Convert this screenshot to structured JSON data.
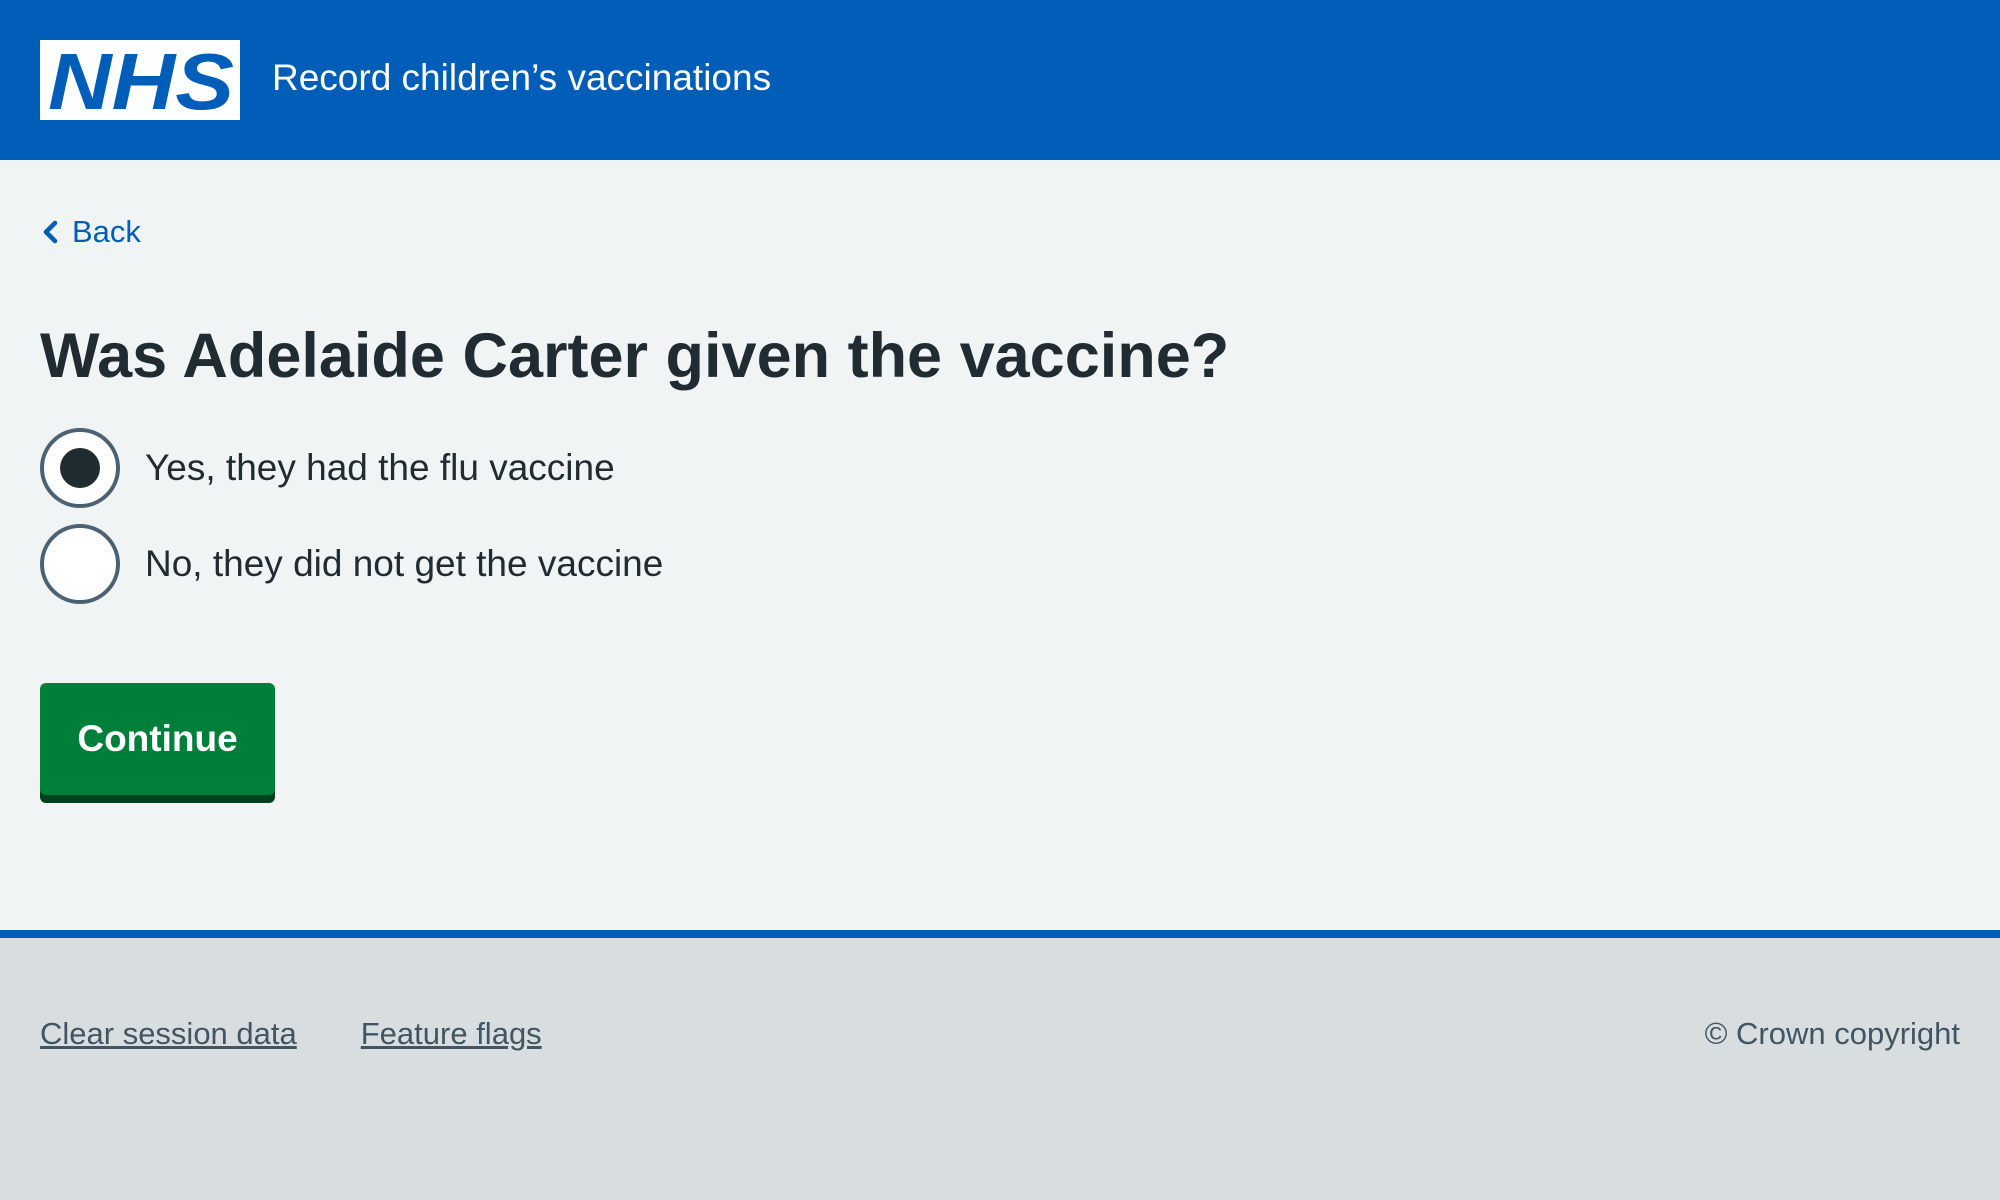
{
  "header": {
    "logo_text": "NHS",
    "service_name": "Record children’s vaccinations"
  },
  "back_link": {
    "label": "Back"
  },
  "question": {
    "title": "Was Adelaide Carter given the vaccine?",
    "options": [
      {
        "label": "Yes, they had the flu vaccine",
        "selected": true
      },
      {
        "label": "No, they did not get the vaccine",
        "selected": false
      }
    ]
  },
  "actions": {
    "continue_label": "Continue"
  },
  "footer": {
    "links": [
      "Clear session data",
      "Feature flags"
    ],
    "copyright": "© Crown copyright"
  },
  "colors": {
    "header_blue": "#005eb8",
    "button_green": "#007f3b",
    "page_background": "#f0f4f5",
    "footer_background": "#d8dde0",
    "text": "#212b32"
  },
  "icons": {
    "logo": "nhs-logo",
    "back": "chevron-left-icon"
  }
}
